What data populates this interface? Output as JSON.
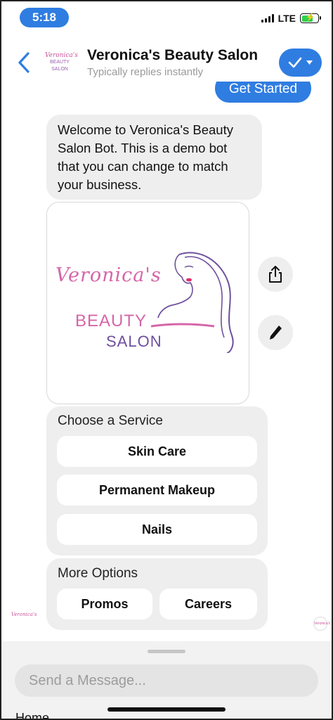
{
  "status_bar": {
    "time": "5:18",
    "network": "LTE",
    "battery_charging": true
  },
  "header": {
    "title": "Veronica's Beauty Salon",
    "subtitle": "Typically replies instantly",
    "avatar_text_1": "Veronica's",
    "avatar_text_2": "BEAUTY SALON",
    "action_icon": "checkmark-dropdown-icon"
  },
  "chat": {
    "get_started_label": "Get Started",
    "welcome_message": "Welcome to Veronica's Beauty Salon Bot. This is a demo bot that you can change to match your business.",
    "image_logo": {
      "script": "Veronica's",
      "line1": "BEAUTY",
      "line2": "SALON"
    },
    "service_panel": {
      "title": "Choose a Service",
      "options": [
        "Skin Care",
        "Permanent Makeup",
        "Nails"
      ]
    },
    "more_panel": {
      "title": "More Options",
      "options": [
        "Promos",
        "Careers"
      ]
    }
  },
  "composer": {
    "placeholder": "Send a Message..."
  },
  "bottom_label": "Home",
  "colors": {
    "accent": "#2f7de1",
    "bubble": "#eeeeee",
    "brand_pink": "#d566a8",
    "brand_purple": "#6e4f9e"
  }
}
